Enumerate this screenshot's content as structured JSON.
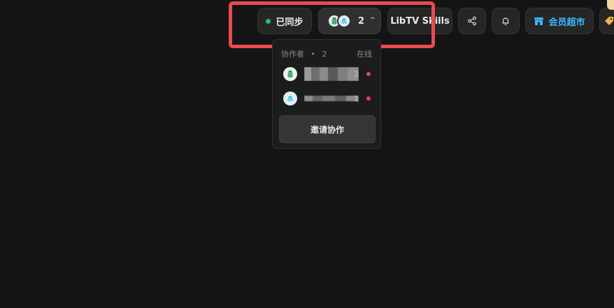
{
  "toolbar": {
    "sync_label": "已同步",
    "collaborator_count": "2",
    "skills_label": "LibTV Skills",
    "vip_label": "会员超市"
  },
  "popover": {
    "title": "协作者",
    "separator": "•",
    "count": "2",
    "online_label": "在线",
    "members": [
      {
        "suffix": "2",
        "status_color": "#e5484d"
      },
      {
        "suffix": "1",
        "status_color": "#e23d6a"
      }
    ],
    "invite_label": "邀请协作"
  },
  "colors": {
    "background": "#141414",
    "sync_green": "#22c26b",
    "vip_blue": "#3bb8ff",
    "highlight_red": "#e94b4f"
  },
  "icons": {
    "share": "share-icon",
    "bell": "bell-icon",
    "store": "store-icon",
    "chevron": "chevron-up-icon"
  }
}
